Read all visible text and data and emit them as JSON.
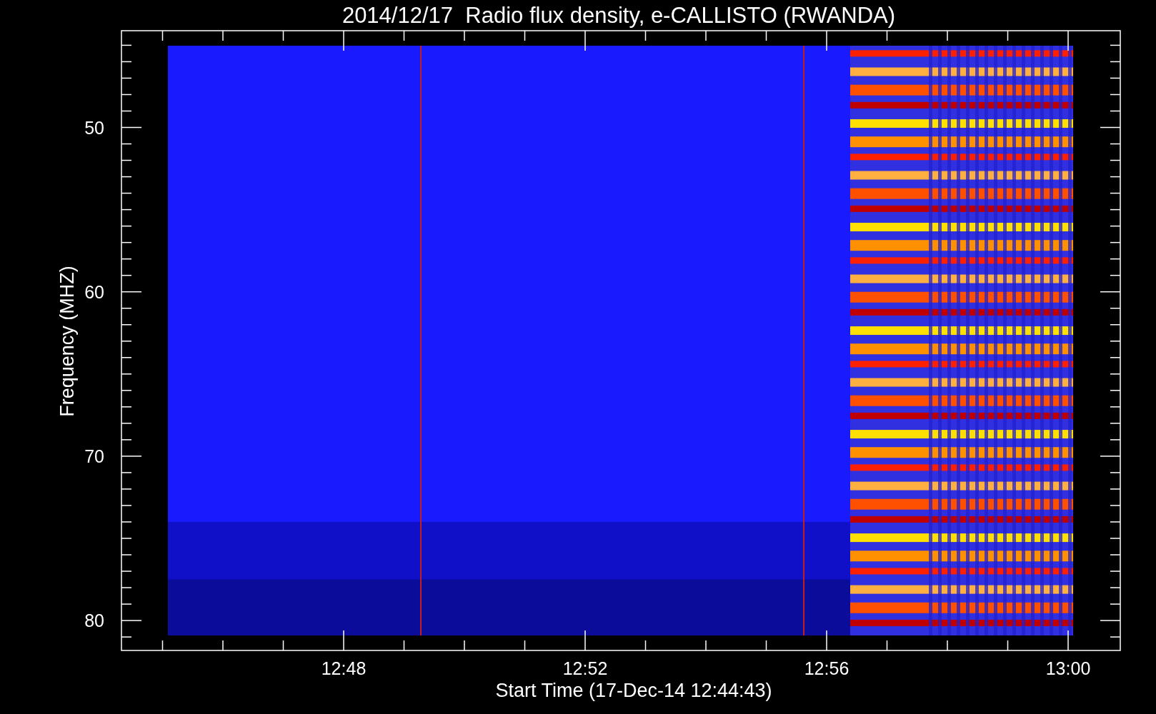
{
  "title": "2014/12/17  Radio flux density, e-CALLISTO (RWANDA)",
  "chart": {
    "xlabel": "Start Time (17-Dec-14 12:44:43)",
    "ylabel": "Frequency (MHZ)",
    "xticks": [
      "12:48",
      "12:52",
      "12:56",
      "13:00"
    ],
    "yticks": [
      "50",
      "60",
      "70",
      "80"
    ]
  }
}
